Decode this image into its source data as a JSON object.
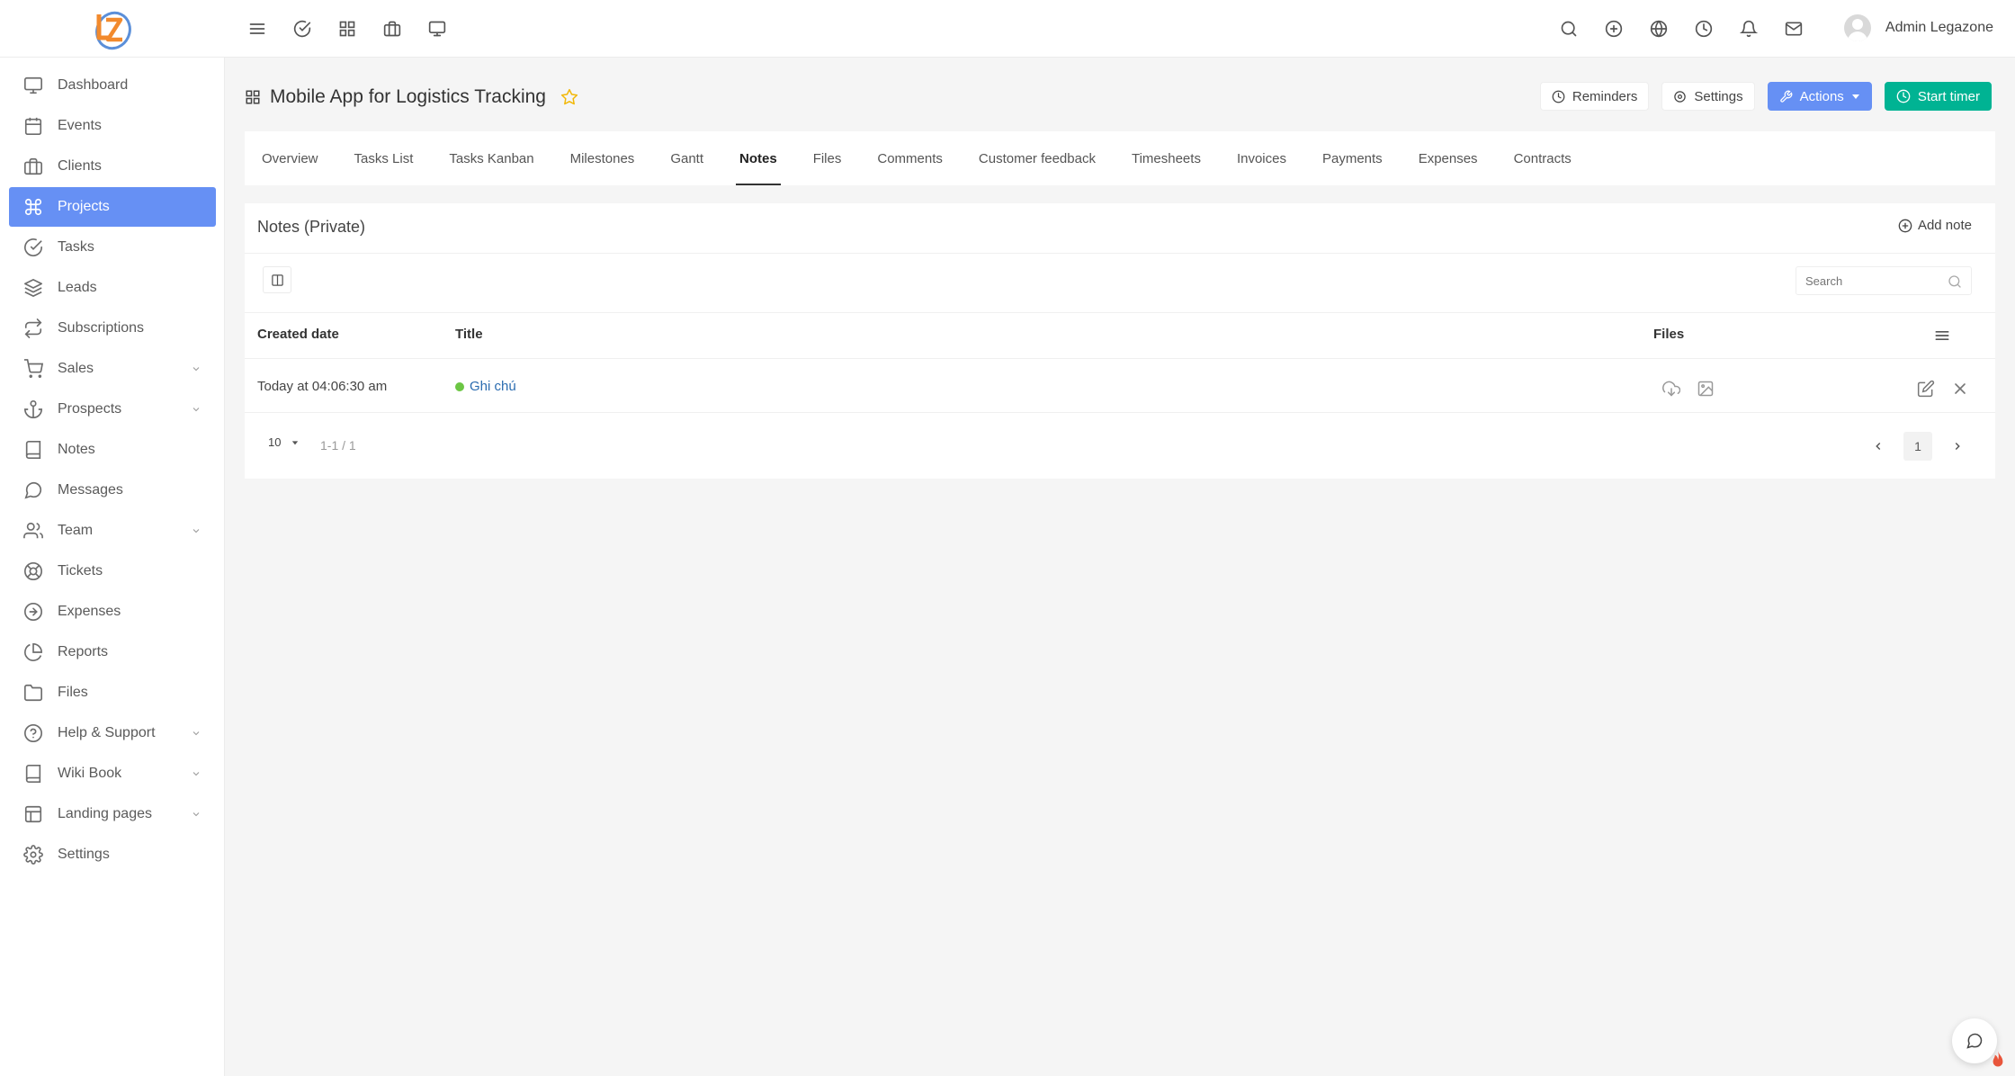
{
  "brand": {
    "logo_text": "LZ"
  },
  "topbar": {
    "left_icons": [
      "menu-icon",
      "check-circle-icon",
      "grid-icon",
      "briefcase-icon",
      "monitor-icon"
    ],
    "right_icons": [
      "search-icon",
      "plus-circle-icon",
      "globe-icon",
      "clock-icon",
      "bell-icon",
      "mail-icon"
    ],
    "user_name": "Admin Legazone"
  },
  "sidebar": {
    "items": [
      {
        "label": "Dashboard",
        "icon": "monitor-icon"
      },
      {
        "label": "Events",
        "icon": "calendar-icon"
      },
      {
        "label": "Clients",
        "icon": "briefcase-icon"
      },
      {
        "label": "Projects",
        "icon": "command-icon",
        "active": true
      },
      {
        "label": "Tasks",
        "icon": "check-circle-icon"
      },
      {
        "label": "Leads",
        "icon": "layers-icon"
      },
      {
        "label": "Subscriptions",
        "icon": "repeat-icon"
      },
      {
        "label": "Sales",
        "icon": "cart-icon",
        "has_submenu": true
      },
      {
        "label": "Prospects",
        "icon": "anchor-icon",
        "has_submenu": true
      },
      {
        "label": "Notes",
        "icon": "book-icon"
      },
      {
        "label": "Messages",
        "icon": "message-icon"
      },
      {
        "label": "Team",
        "icon": "users-icon",
        "has_submenu": true
      },
      {
        "label": "Tickets",
        "icon": "life-buoy-icon"
      },
      {
        "label": "Expenses",
        "icon": "arrow-circle-icon"
      },
      {
        "label": "Reports",
        "icon": "pie-chart-icon"
      },
      {
        "label": "Files",
        "icon": "folder-icon"
      },
      {
        "label": "Help & Support",
        "icon": "help-circle-icon",
        "has_submenu": true
      },
      {
        "label": "Wiki Book",
        "icon": "book-icon",
        "has_submenu": true
      },
      {
        "label": "Landing pages",
        "icon": "layout-icon",
        "has_submenu": true
      },
      {
        "label": "Settings",
        "icon": "gear-icon"
      }
    ]
  },
  "page": {
    "title": "Mobile App for Logistics Tracking",
    "buttons": {
      "reminders": "Reminders",
      "settings": "Settings",
      "actions": "Actions",
      "start_timer": "Start timer"
    }
  },
  "tabs": [
    "Overview",
    "Tasks List",
    "Tasks Kanban",
    "Milestones",
    "Gantt",
    "Notes",
    "Files",
    "Comments",
    "Customer feedback",
    "Timesheets",
    "Invoices",
    "Payments",
    "Expenses",
    "Contracts"
  ],
  "active_tab": "Notes",
  "notes": {
    "card_title": "Notes (Private)",
    "add_note_label": "Add note",
    "search_placeholder": "Search",
    "columns": {
      "created_date": "Created date",
      "title": "Title",
      "files": "Files"
    },
    "rows": [
      {
        "created_date": "Today at 04:06:30 am",
        "title": "Ghi chú"
      }
    ],
    "pagination": {
      "page_size": "10",
      "info": "1-1 / 1",
      "current_page": "1"
    }
  },
  "colors": {
    "primary": "#6690f4",
    "success": "#00b393",
    "star": "#f2b705",
    "note_dot": "#6cc644"
  }
}
